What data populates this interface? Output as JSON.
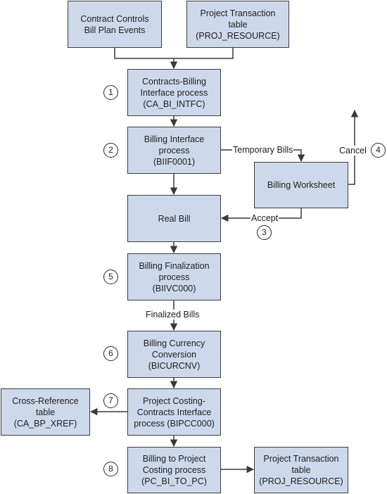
{
  "diagram": {
    "nodes": {
      "bill_plan_events": [
        "Contract Controls",
        "Bill Plan Events"
      ],
      "proj_resource_top": [
        "Project Transaction",
        "table",
        "(PROJ_RESOURCE)"
      ],
      "ca_bi_intfc": [
        "Contracts-Billing",
        "Interface process",
        "(CA_BI_INTFC)"
      ],
      "biif0001": [
        "Billing Interface",
        "process",
        "(BIIF0001)"
      ],
      "billing_worksheet": [
        "Billing Worksheet"
      ],
      "real_bill": [
        "Real Bill"
      ],
      "biivc000": [
        "Billing Finalization",
        "process",
        "(BIIVC000)"
      ],
      "bicurcnv": [
        "Billing Currency",
        "Conversion",
        "(BICURCNV)"
      ],
      "bipcc000": [
        "Project Costing-",
        "Contracts Interface",
        "process (BIPCC000)"
      ],
      "ca_bp_xref": [
        "Cross-Reference",
        "table",
        "(CA_BP_XREF)"
      ],
      "pc_bi_to_pc": [
        "Billing to Project",
        "Costing process",
        "(PC_BI_TO_PC)"
      ],
      "proj_resource_bottom": [
        "Project Transaction",
        "table",
        "(PROJ_RESOURCE)"
      ]
    },
    "edge_labels": {
      "temporary_bills": "Temporary Bills",
      "cancel": "Cancel",
      "accept": "Accept",
      "finalized_bills": "Finalized Bills"
    },
    "steps": [
      "1",
      "2",
      "3",
      "4",
      "5",
      "6",
      "7",
      "8"
    ],
    "colors": {
      "box_fill": "#cdd9eb",
      "box_border": "#3c3c3c",
      "line": "#3a3a3a"
    }
  }
}
